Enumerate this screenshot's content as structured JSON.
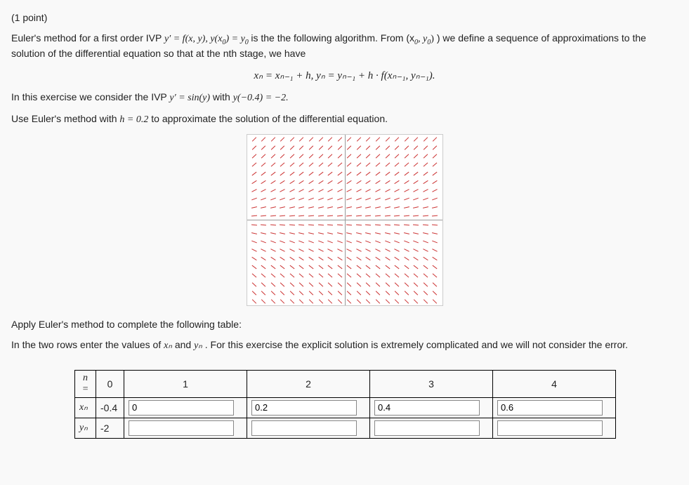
{
  "points_label": "(1 point)",
  "intro_line1_prefix": "Euler's method for a first order IVP ",
  "intro_eq1": "y′ = f(x, y),  y(x",
  "intro_eq1_sub": "0",
  "intro_eq1_mid": ") = y",
  "intro_eq1_sub2": "0",
  "intro_line1_suffix": " is the the following algorithm. From (x",
  "intro_line1_sub3": "0",
  "intro_line1_mid2": ", y",
  "intro_line1_sub4": "0",
  "intro_line1_end": ") we define a sequence of approximations to the solution of the differential equation so that at the nth stage, we have",
  "display_eq": "xₙ = xₙ₋₁ + h,    yₙ = yₙ₋₁ + h · f(xₙ₋₁, yₙ₋₁).",
  "ivp_line_prefix": "In this exercise we consider the IVP ",
  "ivp_eq": "y′ = sin(y)",
  "ivp_with": " with ",
  "ivp_cond": "y(−0.4) = −2.",
  "use_line_prefix": "Use Euler's method with ",
  "use_h": "h = 0.2",
  "use_line_suffix": " to approximate the solution of the differential equation.",
  "apply_line": "Apply Euler's method to complete the following table:",
  "rows_line_prefix": "In the two rows enter the values of ",
  "rows_xn": "xₙ",
  "rows_and": " and ",
  "rows_yn": "yₙ",
  "rows_line_suffix": ". For this exercise the explicit solution is extremely complicated and we will not consider the error.",
  "table": {
    "header_n": "n =",
    "cols": [
      "0",
      "1",
      "2",
      "3",
      "4"
    ],
    "row_x_label": "xₙ",
    "row_y_label": "yₙ",
    "x_fixed": "-0.4",
    "y_fixed": "-2",
    "x_inputs": [
      "0",
      "0.2",
      "0.4",
      "0.6"
    ],
    "y_inputs": [
      "",
      "",
      "",
      ""
    ]
  },
  "chart_data": {
    "type": "direction_field",
    "title": "",
    "xlim": [
      -1.5,
      1.5
    ],
    "ylim": [
      -1.5,
      1.5
    ],
    "equation": "y' = sin(y)",
    "note": "slope field arrows (red) on a grid, slope depends only on y; near y=0 slopes ~0, otherwise tilted"
  }
}
